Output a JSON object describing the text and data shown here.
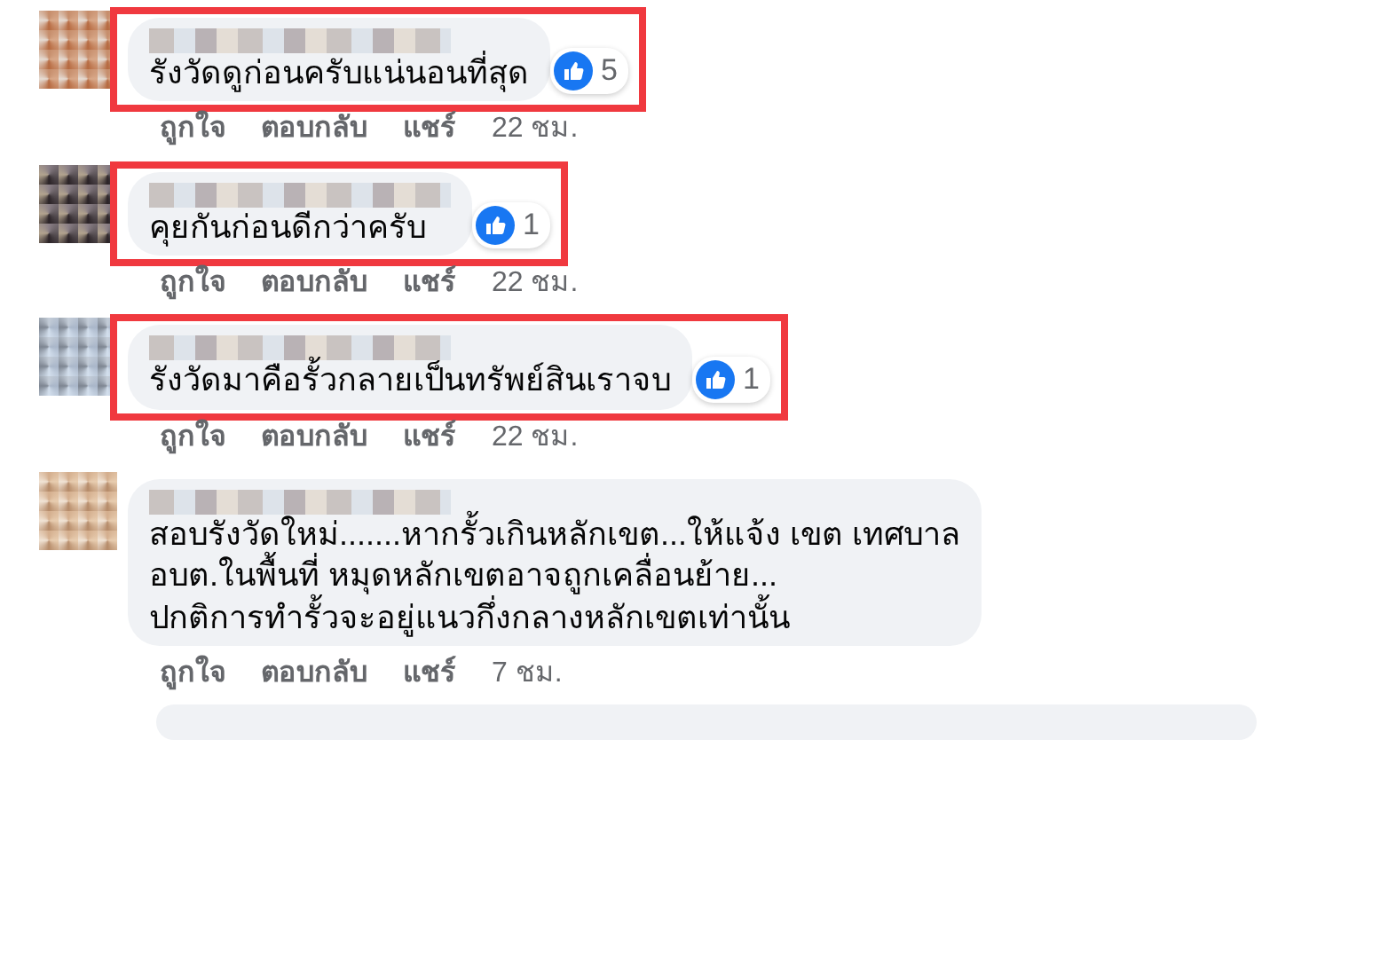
{
  "comments": [
    {
      "text": "รังวัดดูก่อนครับแน่นอนที่สุด",
      "likes": "5",
      "highlighted": true,
      "actions": [
        "ถูกใจ",
        "ตอบกลับ",
        "แชร์"
      ],
      "time": "22 ชม."
    },
    {
      "text": "คุยกันก่อนดีกว่าครับ",
      "likes": "1",
      "highlighted": true,
      "actions": [
        "ถูกใจ",
        "ตอบกลับ",
        "แชร์"
      ],
      "time": "22 ชม."
    },
    {
      "text": "รังวัดมาคือรั้วกลายเป็นทรัพย์สินเราจบ",
      "likes": "1",
      "highlighted": true,
      "actions": [
        "ถูกใจ",
        "ตอบกลับ",
        "แชร์"
      ],
      "time": "22 ชม."
    },
    {
      "text": "สอบรังวัดใหม่.......หากรั้วเกินหลักเขต...ให้แจ้ง เขต เทศบาล\nอบต.ในพื้นที่ หมุดหลักเขตอาจถูกเคลื่อนย้าย...\nปกติการทำรั้วจะอยู่แนวกึ่งกลางหลักเขตเท่านั้น",
      "highlighted": false,
      "actions": [
        "ถูกใจ",
        "ตอบกลับ",
        "แชร์"
      ],
      "time": "7 ชม."
    }
  ]
}
